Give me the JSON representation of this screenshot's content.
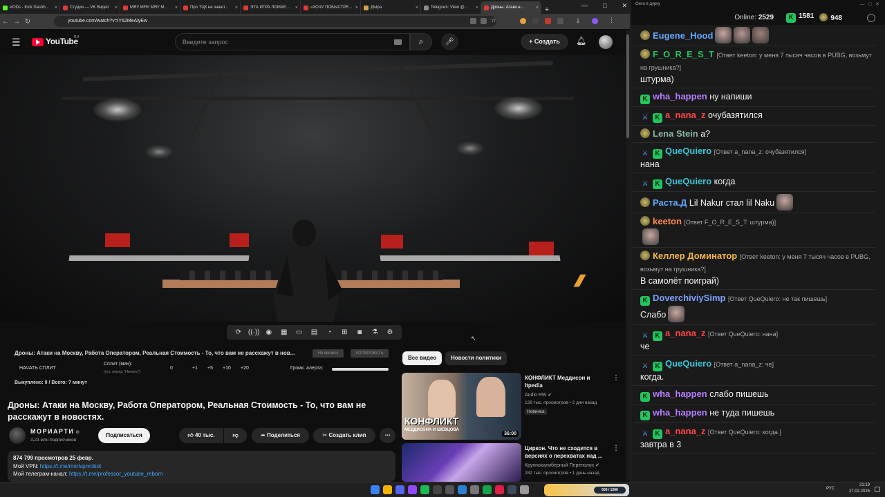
{
  "browser": {
    "tabs": [
      {
        "label": "VODs - Kick Dashb...",
        "color": "#53fc18"
      },
      {
        "label": "Студия — VK Видео",
        "color": "#e23a3a"
      },
      {
        "label": "MЯУ МЯУ МЯУ М...",
        "color": "#e23a3a"
      },
      {
        "label": "Про ТЦК не знают...",
        "color": "#e23a3a"
      },
      {
        "label": "ЭТА ИГРА ЛОМАЕ...",
        "color": "#e23a3a"
      },
      {
        "label": "«ХОЧУ ПОБЫСТРЕ...",
        "color": "#e23a3a"
      },
      {
        "label": "ДЫра",
        "color": "#d9a441"
      },
      {
        "label": "Telegram: View @...",
        "color": "#8c8c8c"
      },
      {
        "label": "Дроны: Атаки н...",
        "color": "#e23a3a"
      }
    ],
    "url": "youtube.com/watch?v=iY62MeAiyEw",
    "new_tab": "+",
    "window_min": "—",
    "window_max": "□",
    "window_close": "✕"
  },
  "youtube": {
    "logo": "YouTube",
    "region": "RU",
    "search_placeholder": "Введите запрос",
    "create_label": "Создать",
    "video_title": "Дроны: Атаки на Москву, Работа Оператором, Реальная Стоимость - То, что вам не расскажут в новостях.",
    "split": {
      "title": "Дроны: Атаки на Москву, Работа Оператором, Реальная Стоимость - То, что вам не расскажут в нов...",
      "btn1": "На миниок",
      "btn2": "КОПИРОВАТЬ",
      "start": "НАЧАТЬ СПЛИТ",
      "split_min": "Сплит (мин):",
      "split_hint": "(уст. перед \"Начать\")",
      "vals": [
        "0",
        "+1",
        "+5",
        "+10",
        "+20"
      ],
      "volume": "Громк. алерта:",
      "bought": "Выкуплено: 0 / Всего: ? минут"
    },
    "channel": {
      "name": "МОРИАРТИ",
      "subs": "3,23 млн подписчиков",
      "subscribe": "Подписаться"
    },
    "actions": {
      "likes": "40 тыс.",
      "share": "Поделиться",
      "clip": "Создать клип",
      "more": "⋯"
    },
    "description": {
      "stats": "874 799 просмотров  25 февр.",
      "vpn_label": "Мой VPN: ",
      "vpn_link": "https://t.me/morivpnrobot",
      "tg_label": "Мой телеграм-канал: ",
      "tg_link": "https://t.me/professor_youtube_reborn"
    },
    "chips": [
      "Все видео",
      "Новости политики"
    ],
    "recommended": [
      {
        "title": "КОНФЛИКТ Меддисон и Itpedia",
        "channel": "Audio RW",
        "meta": "128 тыс. просмотров • 2 дня назад",
        "badge": "Новинка",
        "duration": "36:00",
        "thumb_title": "КОНФЛИКТ",
        "thumb_sub": "МЕДДИСОНА И ШЕВЦОВА"
      },
      {
        "title": "Циркон. Что не сходится в версиях о перехватах над ...",
        "channel": "Крупнокалиберный Переполох",
        "meta": "282 тыс. просмотров • 1 день назад"
      }
    ]
  },
  "chat": {
    "window_title": "Окно в дурку",
    "online_label": "Online:",
    "online": "2529",
    "kick_count": "1581",
    "other_count": "948",
    "messages": [
      {
        "name": "Eugene_Hood",
        "color": "#5fa8ff",
        "reply": "",
        "text": "",
        "badges": [
          "avatar"
        ],
        "emotes": 3
      },
      {
        "name": "F_O_R_E_S_T",
        "color": "#22c55e",
        "reply": "[Ответ keeton: у меня 7 тысяч часов в PUBG, возьмут на грушника?]",
        "text": "штурма)",
        "badges": [
          "avatar"
        ]
      },
      {
        "name": "wha_happen",
        "color": "#b77dff",
        "reply": "",
        "text": "ну напиши",
        "badges": [
          "kick"
        ]
      },
      {
        "name": "a_nana_z",
        "color": "#ff4545",
        "reply": "",
        "text": "очубазятился",
        "badges": [
          "sword",
          "kick"
        ]
      },
      {
        "name": "Lena Stein",
        "color": "#8ab4a0",
        "reply": "",
        "text": "а?",
        "badges": [
          "avatar"
        ]
      },
      {
        "name": "QueQuiero",
        "color": "#38c6d6",
        "reply": "[Ответ a_nana_z: очубазятился]",
        "text": "нана",
        "badges": [
          "sword",
          "kick"
        ]
      },
      {
        "name": "QueQuiero",
        "color": "#38c6d6",
        "reply": "",
        "text": "когда",
        "badges": [
          "sword",
          "kick"
        ]
      },
      {
        "name": "Раста.Д",
        "color": "#5fa8ff",
        "reply": "",
        "text": "Lil Nakur стал lil Naku",
        "badges": [
          "avatar"
        ],
        "emotes": 1
      },
      {
        "name": "keeton",
        "color": "#ff8a4c",
        "reply": "[Ответ F_O_R_E_S_T: штурма)]",
        "text": "",
        "badges": [
          "avatar"
        ],
        "emotes": 1
      },
      {
        "name": "Келлер Доминатор",
        "color": "#f5b942",
        "reply": "[Ответ keeton: у меня 7 тысяч часов в PUBG, возьмут на грушника?]",
        "text": "В самолёт поиграй)",
        "badges": [
          "avatar"
        ]
      },
      {
        "name": "DoverchiviySimp",
        "color": "#7aa0ff",
        "reply": "[Ответ QueQuiero: не так пишешь]",
        "text": "Слабо",
        "badges": [
          "kick"
        ],
        "emotes": 1
      },
      {
        "name": "a_nana_z",
        "color": "#ff4545",
        "reply": "[Ответ QueQuiero: нана]",
        "text": "че",
        "badges": [
          "sword",
          "kick"
        ]
      },
      {
        "name": "QueQuiero",
        "color": "#38c6d6",
        "reply": "[Ответ a_nana_z: че]",
        "text": "когда.",
        "badges": [
          "sword",
          "kick"
        ]
      },
      {
        "name": "wha_happen",
        "color": "#b77dff",
        "reply": "",
        "text": "слабо пишешь",
        "badges": [
          "kick"
        ]
      },
      {
        "name": "wha_happen",
        "color": "#b77dff",
        "reply": "",
        "text": "не туда пишешь",
        "badges": [
          "kick"
        ]
      },
      {
        "name": "a_nana_z",
        "color": "#ff4545",
        "reply": "[Ответ QueQuiero: когда.]",
        "text": "завтра в 3",
        "badges": [
          "sword",
          "kick"
        ]
      }
    ]
  },
  "taskbar": {
    "lang": "РУС",
    "time": "21:19",
    "date": "27.02.2026",
    "overlay": "500 / 1500"
  }
}
